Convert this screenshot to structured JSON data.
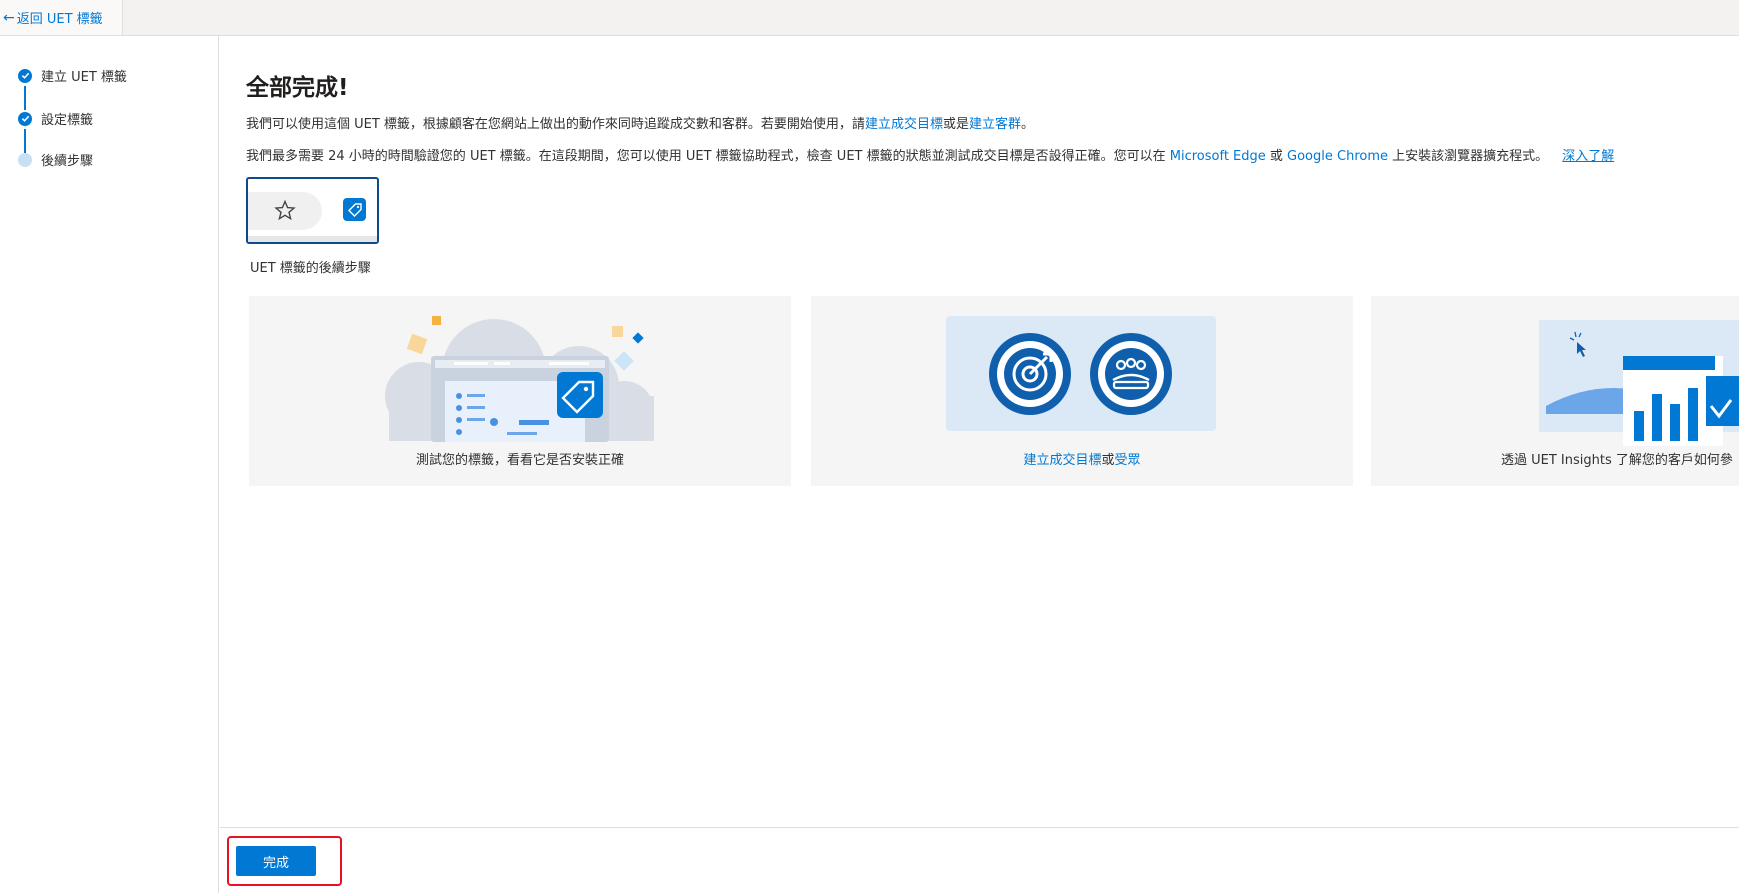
{
  "topbar": {
    "back_label": "返回 UET 標籤",
    "back_arrow": "←"
  },
  "steps": [
    {
      "label": "建立 UET 標籤",
      "status": "done"
    },
    {
      "label": "設定標籤",
      "status": "done"
    },
    {
      "label": "後續步驟",
      "status": "current"
    }
  ],
  "main": {
    "title": "全部完成!",
    "para1": {
      "text": "我們可以使用這個 UET 標籤，根據顧客在您網站上做出的動作來同時追蹤成交數和客群。若要開始使用，請",
      "link1": "建立成交目標",
      "mid": "或是",
      "link2": "建立客群",
      "end": "。"
    },
    "para2": {
      "text": "我們最多需要 24 小時的時間驗證您的 UET 標籤。在這段期間，您可以使用 UET 標籤協助程式，檢查 UET 標籤的狀態並測試成交目標是否設得正確。您可以在 ",
      "link_edge": "Microsoft Edge",
      "or": " 或 ",
      "link_chrome": "Google Chrome",
      "end": " 上安裝該瀏覽器擴充程式。",
      "learn_more": "深入了解"
    },
    "extension_caption": "UET 標籤的後續步驟",
    "cards": [
      {
        "label": "測試您的標籤，看看它是否安裝正確"
      },
      {
        "link1": "建立成交目標",
        "mid": "或",
        "link2": "受眾"
      },
      {
        "label": "透過 UET Insights 了解您的客戶如何參"
      }
    ]
  },
  "footer": {
    "done_label": "完成"
  },
  "colors": {
    "accent": "#0078d4",
    "highlight": "#e81123",
    "card_bg": "#f5f5f5"
  },
  "icons": [
    "left-arrow-icon",
    "check-icon",
    "star-icon",
    "tag-icon",
    "target-icon",
    "audience-icon",
    "cursor-icon"
  ]
}
